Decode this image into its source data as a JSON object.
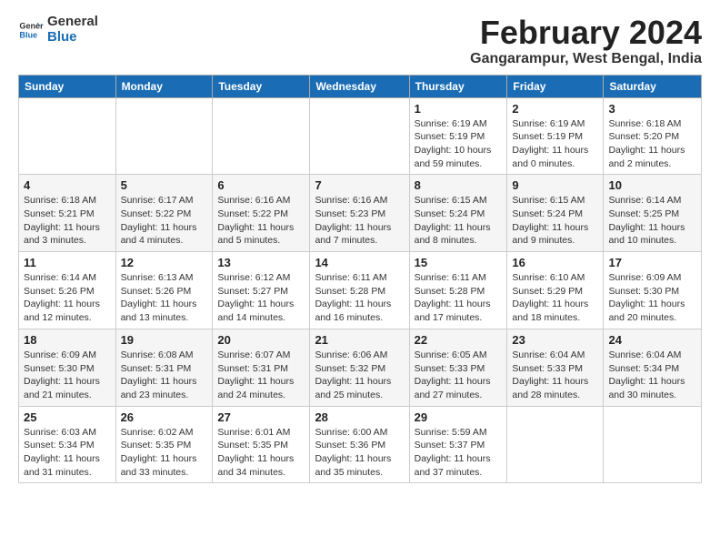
{
  "logo": {
    "line1": "General",
    "line2": "Blue"
  },
  "title": "February 2024",
  "location": "Gangarampur, West Bengal, India",
  "days_header": [
    "Sunday",
    "Monday",
    "Tuesday",
    "Wednesday",
    "Thursday",
    "Friday",
    "Saturday"
  ],
  "weeks": [
    [
      {
        "day": "",
        "info": ""
      },
      {
        "day": "",
        "info": ""
      },
      {
        "day": "",
        "info": ""
      },
      {
        "day": "",
        "info": ""
      },
      {
        "day": "1",
        "info": "Sunrise: 6:19 AM\nSunset: 5:19 PM\nDaylight: 10 hours\nand 59 minutes."
      },
      {
        "day": "2",
        "info": "Sunrise: 6:19 AM\nSunset: 5:19 PM\nDaylight: 11 hours\nand 0 minutes."
      },
      {
        "day": "3",
        "info": "Sunrise: 6:18 AM\nSunset: 5:20 PM\nDaylight: 11 hours\nand 2 minutes."
      }
    ],
    [
      {
        "day": "4",
        "info": "Sunrise: 6:18 AM\nSunset: 5:21 PM\nDaylight: 11 hours\nand 3 minutes."
      },
      {
        "day": "5",
        "info": "Sunrise: 6:17 AM\nSunset: 5:22 PM\nDaylight: 11 hours\nand 4 minutes."
      },
      {
        "day": "6",
        "info": "Sunrise: 6:16 AM\nSunset: 5:22 PM\nDaylight: 11 hours\nand 5 minutes."
      },
      {
        "day": "7",
        "info": "Sunrise: 6:16 AM\nSunset: 5:23 PM\nDaylight: 11 hours\nand 7 minutes."
      },
      {
        "day": "8",
        "info": "Sunrise: 6:15 AM\nSunset: 5:24 PM\nDaylight: 11 hours\nand 8 minutes."
      },
      {
        "day": "9",
        "info": "Sunrise: 6:15 AM\nSunset: 5:24 PM\nDaylight: 11 hours\nand 9 minutes."
      },
      {
        "day": "10",
        "info": "Sunrise: 6:14 AM\nSunset: 5:25 PM\nDaylight: 11 hours\nand 10 minutes."
      }
    ],
    [
      {
        "day": "11",
        "info": "Sunrise: 6:14 AM\nSunset: 5:26 PM\nDaylight: 11 hours\nand 12 minutes."
      },
      {
        "day": "12",
        "info": "Sunrise: 6:13 AM\nSunset: 5:26 PM\nDaylight: 11 hours\nand 13 minutes."
      },
      {
        "day": "13",
        "info": "Sunrise: 6:12 AM\nSunset: 5:27 PM\nDaylight: 11 hours\nand 14 minutes."
      },
      {
        "day": "14",
        "info": "Sunrise: 6:11 AM\nSunset: 5:28 PM\nDaylight: 11 hours\nand 16 minutes."
      },
      {
        "day": "15",
        "info": "Sunrise: 6:11 AM\nSunset: 5:28 PM\nDaylight: 11 hours\nand 17 minutes."
      },
      {
        "day": "16",
        "info": "Sunrise: 6:10 AM\nSunset: 5:29 PM\nDaylight: 11 hours\nand 18 minutes."
      },
      {
        "day": "17",
        "info": "Sunrise: 6:09 AM\nSunset: 5:30 PM\nDaylight: 11 hours\nand 20 minutes."
      }
    ],
    [
      {
        "day": "18",
        "info": "Sunrise: 6:09 AM\nSunset: 5:30 PM\nDaylight: 11 hours\nand 21 minutes."
      },
      {
        "day": "19",
        "info": "Sunrise: 6:08 AM\nSunset: 5:31 PM\nDaylight: 11 hours\nand 23 minutes."
      },
      {
        "day": "20",
        "info": "Sunrise: 6:07 AM\nSunset: 5:31 PM\nDaylight: 11 hours\nand 24 minutes."
      },
      {
        "day": "21",
        "info": "Sunrise: 6:06 AM\nSunset: 5:32 PM\nDaylight: 11 hours\nand 25 minutes."
      },
      {
        "day": "22",
        "info": "Sunrise: 6:05 AM\nSunset: 5:33 PM\nDaylight: 11 hours\nand 27 minutes."
      },
      {
        "day": "23",
        "info": "Sunrise: 6:04 AM\nSunset: 5:33 PM\nDaylight: 11 hours\nand 28 minutes."
      },
      {
        "day": "24",
        "info": "Sunrise: 6:04 AM\nSunset: 5:34 PM\nDaylight: 11 hours\nand 30 minutes."
      }
    ],
    [
      {
        "day": "25",
        "info": "Sunrise: 6:03 AM\nSunset: 5:34 PM\nDaylight: 11 hours\nand 31 minutes."
      },
      {
        "day": "26",
        "info": "Sunrise: 6:02 AM\nSunset: 5:35 PM\nDaylight: 11 hours\nand 33 minutes."
      },
      {
        "day": "27",
        "info": "Sunrise: 6:01 AM\nSunset: 5:35 PM\nDaylight: 11 hours\nand 34 minutes."
      },
      {
        "day": "28",
        "info": "Sunrise: 6:00 AM\nSunset: 5:36 PM\nDaylight: 11 hours\nand 35 minutes."
      },
      {
        "day": "29",
        "info": "Sunrise: 5:59 AM\nSunset: 5:37 PM\nDaylight: 11 hours\nand 37 minutes."
      },
      {
        "day": "",
        "info": ""
      },
      {
        "day": "",
        "info": ""
      }
    ]
  ]
}
